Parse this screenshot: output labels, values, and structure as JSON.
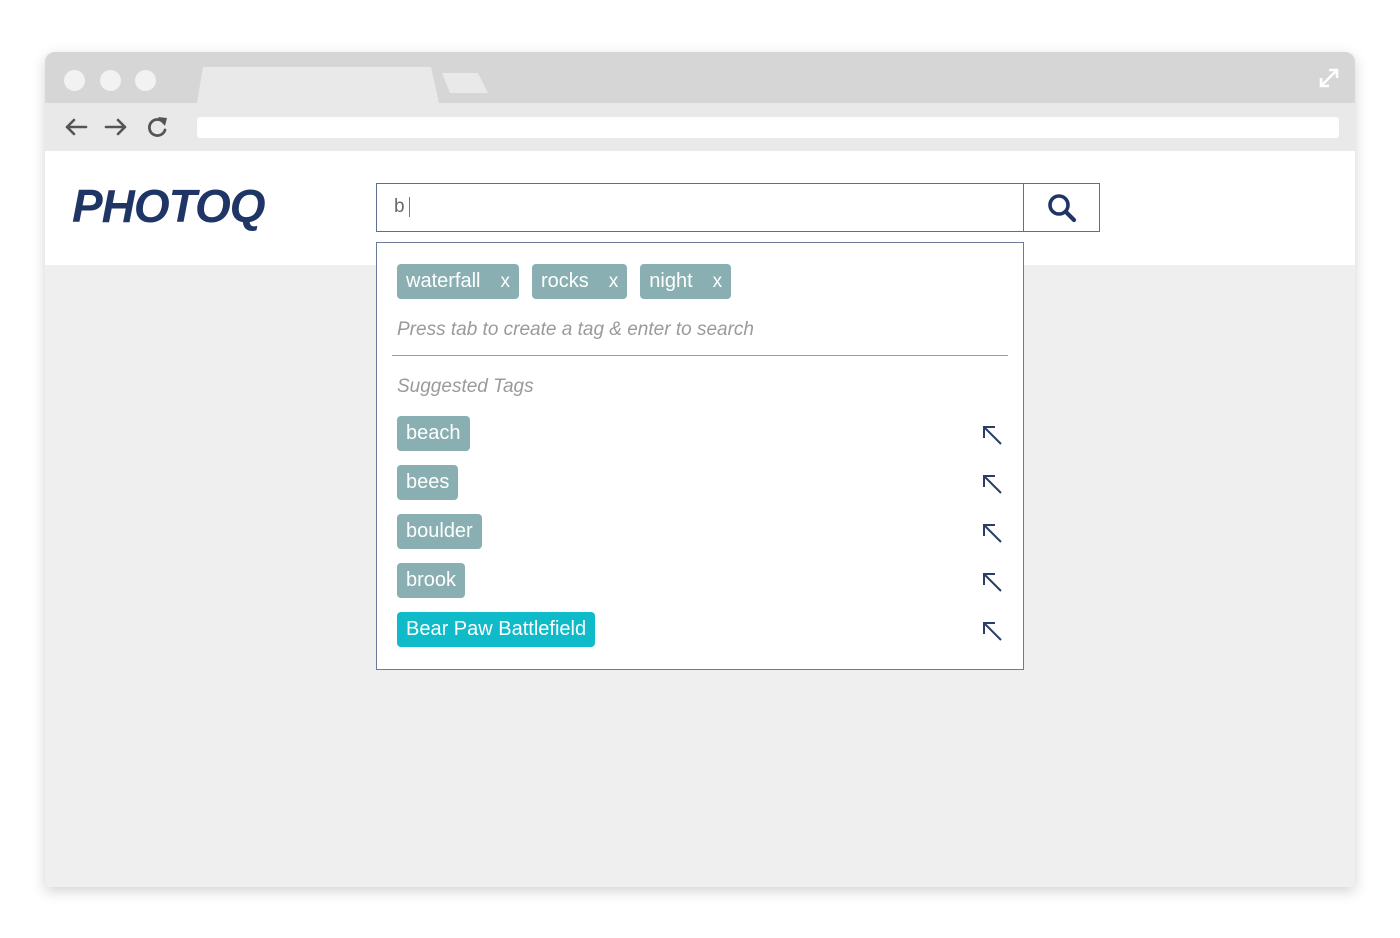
{
  "app": {
    "logo": "PHOTOQ"
  },
  "search": {
    "value": "b"
  },
  "selected_tags": [
    {
      "label": "waterfall",
      "remove": "x"
    },
    {
      "label": "rocks",
      "remove": "x"
    },
    {
      "label": "night",
      "remove": "x"
    }
  ],
  "hint": "Press tab to create a tag & enter to search",
  "suggestions": {
    "title": "Suggested Tags",
    "items": [
      {
        "label": "beach"
      },
      {
        "label": "bees"
      },
      {
        "label": "boulder"
      },
      {
        "label": "brook"
      },
      {
        "label": "Bear Paw Battlefield",
        "highlighted": true
      }
    ]
  },
  "colors": {
    "brand": "#1e3565",
    "tag": "#8aafb2",
    "tag_highlight": "#0fbbc9"
  },
  "icons": {
    "search": "magnifier-icon",
    "insert": "arrow-up-left-icon",
    "expand": "expand-icon"
  }
}
